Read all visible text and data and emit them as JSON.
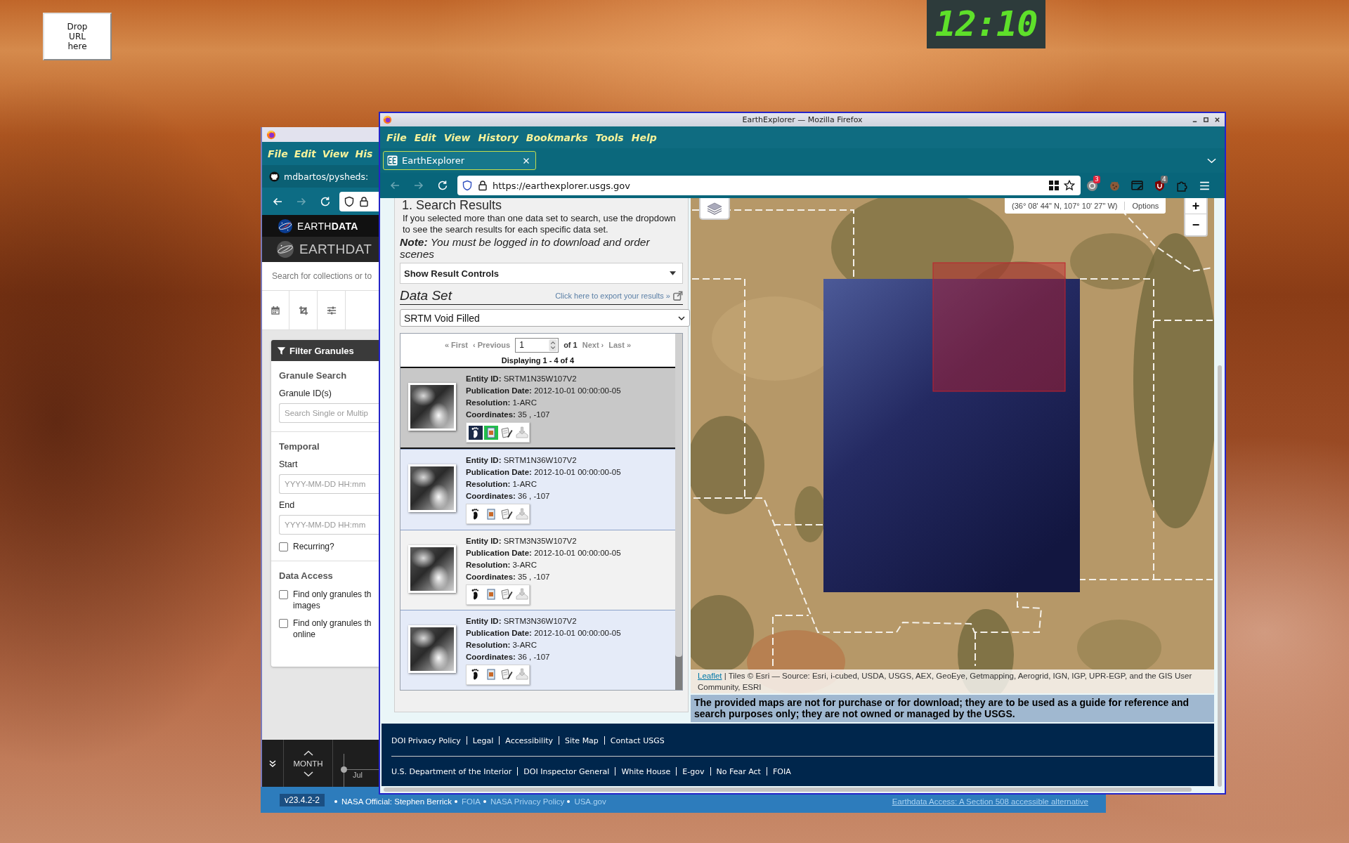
{
  "desktop": {
    "drop_target": "Drop URL here",
    "clock": "12:10"
  },
  "back_window": {
    "menu": [
      "File",
      "Edit",
      "View",
      "His"
    ],
    "tab": {
      "title": "mdbartos/pysheds:"
    },
    "nav": {
      "back": {
        "disabled": false
      },
      "forward": {
        "disabled": true
      }
    },
    "brand": "EARTH**DATA**",
    "site_title": "EARTHDAT",
    "search": {
      "placeholder": "Search for collections or to"
    },
    "filter": {
      "title": "Filter Granules",
      "sections": [
        {
          "title": "Granule Search",
          "items": [
            {
              "kind": "field",
              "label": "Granule ID(s)",
              "placeholder": "Search Single or Multip"
            }
          ]
        },
        {
          "title": "Temporal",
          "items": [
            {
              "kind": "field",
              "label": "Start",
              "placeholder": "YYYY-MM-DD HH:mm"
            },
            {
              "kind": "field",
              "label": "End",
              "placeholder": "YYYY-MM-DD HH:mm"
            },
            {
              "kind": "checkbox",
              "lines": [
                "Recurring?"
              ],
              "checked": false
            }
          ]
        },
        {
          "title": "Data Access",
          "items": [
            {
              "kind": "checkbox",
              "lines": [
                "Find only granules th",
                "images"
              ],
              "checked": false
            },
            {
              "kind": "checkbox",
              "lines": [
                "Find only granules th",
                "online"
              ],
              "checked": false
            }
          ]
        }
      ]
    },
    "timeline": {
      "zoom": "MONTH",
      "tick": "Jul"
    },
    "footer": {
      "version": "v23.4.2-2",
      "items": [
        {
          "kind": "text",
          "label": "NASA Official: Stephen Berrick"
        },
        {
          "kind": "link",
          "label": "FOIA"
        },
        {
          "kind": "link",
          "label": "NASA Privacy Policy"
        },
        {
          "kind": "link",
          "label": "USA.gov"
        }
      ],
      "accessibility_link": "Earthdata Access: A Section 508 accessible alternative"
    }
  },
  "window": {
    "title": "EarthExplorer — Mozilla Firefox",
    "menu": [
      "File",
      "Edit",
      "View",
      "History",
      "Bookmarks",
      "Tools",
      "Help"
    ],
    "tabs": [
      {
        "title": "EarthExplorer",
        "selected": true
      }
    ],
    "nav": {
      "back": {
        "disabled": true
      },
      "forward": {
        "disabled": true
      }
    },
    "url": "https://earthexplorer.usgs.gov",
    "extensions": [
      {
        "kind": "ring",
        "badge": "3",
        "color": "#e0243c"
      },
      {
        "kind": "cookie"
      },
      {
        "kind": "screen"
      },
      {
        "kind": "shield",
        "badge": "4",
        "color": "#6e6e6e"
      },
      {
        "kind": "puzzle"
      }
    ],
    "page": {
      "heading": "1. Search Results",
      "intro": "If you selected more than one data set to search, use the dropdown to see the search results for each specific data set.",
      "note": "**Note:** You must be logged in to download and order scenes",
      "result_controls": {
        "label": "Show Result Controls",
        "expanded": false
      },
      "data_set": {
        "heading": "Data Set",
        "export_link": "Click here to export your results »",
        "selected": "SRTM Void Filled"
      },
      "pagination": {
        "first": "« First",
        "previous": "‹ Previous",
        "page": "1",
        "total": "of 1",
        "next": "Next ›",
        "last": "Last »",
        "summary": "Displaying 1 - 4 of 4"
      },
      "results": [
        {
          "lines": [
            "**Entity ID:** SRTM1N35W107V2",
            "**Publication Date:** 2012-10-01 00:00:00-05",
            "**Resolution:** 1-ARC",
            "**Coordinates:** 35 , -107"
          ],
          "selected": true,
          "footprint_shown": true,
          "browse_shown": true
        },
        {
          "lines": [
            "**Entity ID:** SRTM1N36W107V2",
            "**Publication Date:** 2012-10-01 00:00:00-05",
            "**Resolution:** 1-ARC",
            "**Coordinates:** 36 , -107"
          ],
          "selected": false,
          "footprint_shown": false,
          "browse_shown": false
        },
        {
          "lines": [
            "**Entity ID:** SRTM3N35W107V2",
            "**Publication Date:** 2012-10-01 00:00:00-05",
            "**Resolution:** 3-ARC",
            "**Coordinates:** 35 , -107"
          ],
          "selected": false,
          "footprint_shown": false,
          "browse_shown": false
        },
        {
          "lines": [
            "**Entity ID:** SRTM3N36W107V2",
            "**Publication Date:** 2012-10-01 00:00:00-05",
            "**Resolution:** 3-ARC",
            "**Coordinates:** 36 , -107"
          ],
          "selected": false,
          "footprint_shown": false,
          "browse_shown": false
        }
      ]
    },
    "map": {
      "coordinates": "(36° 08' 44\" N, 107° 10' 27\" W)",
      "options": "Options",
      "zoom_in": "+",
      "zoom_out": "−",
      "attribution_link": "Leaflet",
      "attribution": "| Tiles © Esri — Source: Esri, i-cubed, USDA, USGS, AEX, GeoEye, Getmapping, Aerogrid, IGN, IGP, UPR-EGP, and the GIS User Community, ESRI",
      "disclaimer": "The provided maps are not for purchase or for download; they are to be used as a guide for reference and search purposes only; they are not owned or managed by the USGS."
    },
    "footer": {
      "links": [
        "DOI Privacy Policy",
        "Legal",
        "Accessibility",
        "Site Map",
        "Contact USGS"
      ],
      "agency_links": [
        "U.S. Department of the Interior",
        "DOI Inspector General",
        "White House",
        "E-gov",
        "No Fear Act",
        "FOIA"
      ]
    }
  }
}
